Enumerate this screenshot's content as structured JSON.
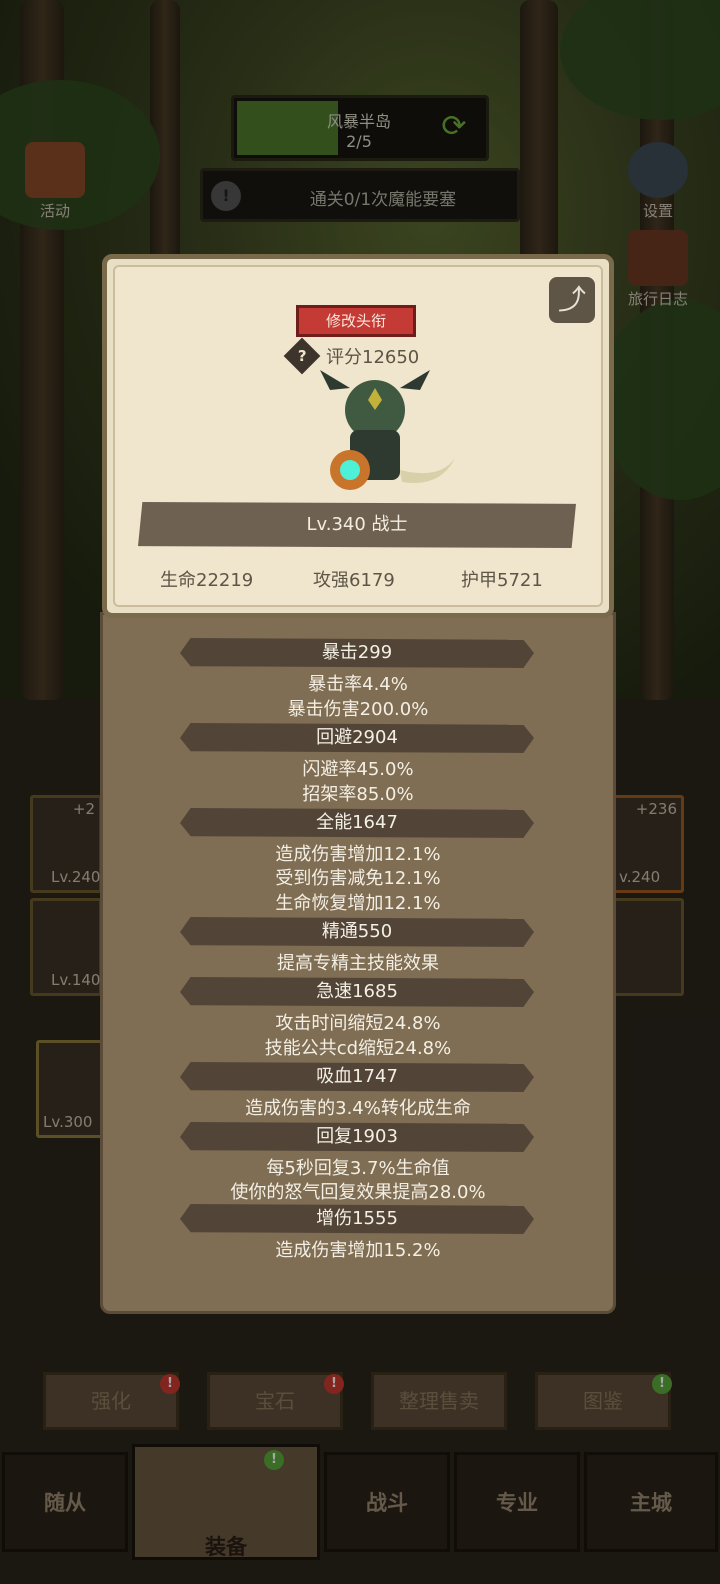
{
  "stage": {
    "name": "风暴半岛",
    "progress": "2/5",
    "fill_fraction": 0.4
  },
  "quest": {
    "text": "通关0/1次魔能要塞"
  },
  "side_left": {
    "activity": "活动"
  },
  "side_right": {
    "settings": "设置",
    "travel_log": "旅行日志"
  },
  "profile": {
    "change_title": "修改头衔",
    "score": "评分12650",
    "level_class": "Lv.340 战士",
    "hp": "生命22219",
    "attack": "攻强6179",
    "armor": "护甲5721"
  },
  "stats": [
    {
      "header": "暴击299",
      "lines": [
        "暴击率4.4%",
        "暴击伤害200.0%"
      ]
    },
    {
      "header": "回避2904",
      "lines": [
        "闪避率45.0%",
        "招架率85.0%"
      ]
    },
    {
      "header": "全能1647",
      "lines": [
        "造成伤害增加12.1%",
        "受到伤害减免12.1%",
        "生命恢复增加12.1%"
      ]
    },
    {
      "header": "精通550",
      "lines": [
        "提高专精主技能效果"
      ]
    },
    {
      "header": "急速1685",
      "lines": [
        "攻击时间缩短24.8%",
        "技能公共cd缩短24.8%"
      ]
    },
    {
      "header": "吸血1747",
      "lines": [
        "造成伤害的3.4%转化成生命"
      ]
    },
    {
      "header": "回复1903",
      "lines": [
        "每5秒回复3.7%生命值",
        "使你的怒气回复效果提高28.0%"
      ]
    },
    {
      "header": "增伤1555",
      "lines": [
        "造成伤害增加15.2%"
      ]
    }
  ],
  "equipment_slots": [
    {
      "plus": "+2",
      "level": "Lv.240"
    },
    {
      "level": "Lv.140"
    },
    {
      "level": "Lv.300"
    },
    {
      "plus": "+236",
      "level": "v.240"
    }
  ],
  "bottom_buttons": {
    "enhance": "强化",
    "gem": "宝石",
    "sort_sell": "整理售卖",
    "codex": "图鉴"
  },
  "nav": {
    "followers": "随从",
    "equipment": "装备",
    "battle": "战斗",
    "profession": "专业",
    "main_city": "主城"
  },
  "badges": {
    "alert": "!"
  },
  "colors": {
    "title_button": "#c43a34",
    "panel": "#e9dfc4",
    "stat_header": "#524538"
  }
}
